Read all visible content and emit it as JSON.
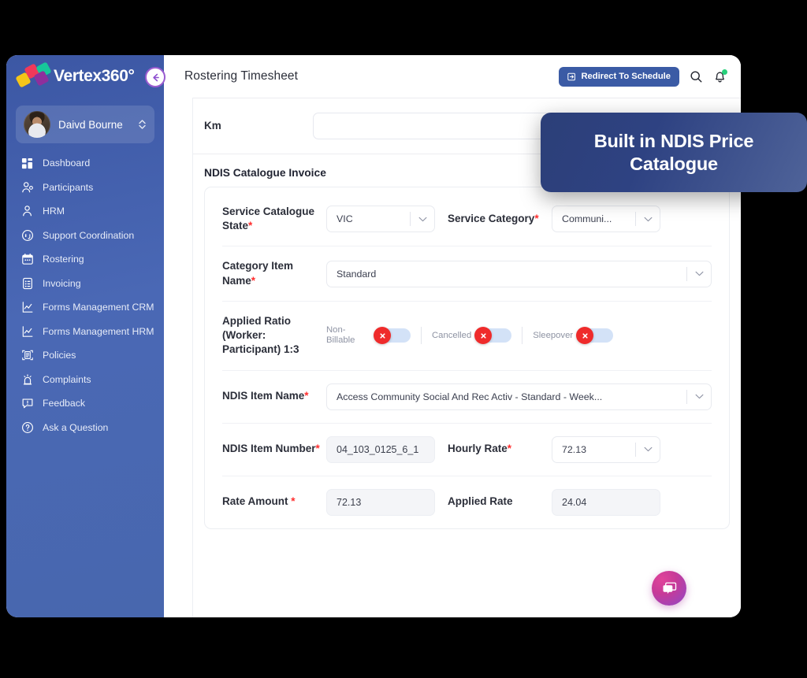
{
  "brand": {
    "name": "Vertex360°",
    "logo_icon": "vertex-diamond-logo"
  },
  "profile": {
    "name": "Daivd Bourne",
    "chevron_icon": "up-down-chevron-icon",
    "avatar_icon": "user-avatar"
  },
  "sidebar": {
    "items": [
      {
        "label": "Dashboard",
        "icon": "dashboard-grid-icon"
      },
      {
        "label": "Participants",
        "icon": "participants-people-icon"
      },
      {
        "label": "HRM",
        "icon": "hrm-person-icon"
      },
      {
        "label": "Support Coordination",
        "icon": "headset-support-icon"
      },
      {
        "label": "Rostering",
        "icon": "calendar-icon"
      },
      {
        "label": "Invoicing",
        "icon": "invoice-document-icon"
      },
      {
        "label": "Forms Management CRM",
        "icon": "chart-line-icon"
      },
      {
        "label": "Forms Management HRM",
        "icon": "chart-line-icon"
      },
      {
        "label": "Policies",
        "icon": "policies-frame-icon"
      },
      {
        "label": "Complaints",
        "icon": "complaints-siren-icon"
      },
      {
        "label": "Feedback",
        "icon": "feedback-comment-icon"
      },
      {
        "label": "Ask a Question",
        "icon": "question-circle-icon"
      }
    ]
  },
  "topbar": {
    "back_icon": "back-arrow-icon",
    "title": "Rostering Timesheet",
    "redirect_label": "Redirect To Schedule",
    "redirect_icon": "redirect-export-icon",
    "search_icon": "search-icon",
    "bell_icon": "notification-bell-icon",
    "bell_badge": true
  },
  "callout": {
    "text": "Built in NDIS Price Catalogue",
    "color": "#2e4282"
  },
  "form": {
    "km": {
      "label": "Km",
      "value": "",
      "placeholder": ""
    },
    "section_title": "NDIS Catalogue Invoice",
    "service_catalogue_state": {
      "label": "Service Catalogue State",
      "required": true,
      "value": "VIC"
    },
    "service_category": {
      "label": "Service Category",
      "required": true,
      "value": "Communi..."
    },
    "category_item_name": {
      "label": "Category Item Name",
      "required": true,
      "value": "Standard"
    },
    "applied_ratio": {
      "label": "Applied Ratio (Worker: Participant) 1:3"
    },
    "toggles": [
      {
        "label": "Non-Billable",
        "state": "off",
        "icon": "toggle-off-cross-icon"
      },
      {
        "label": "Cancelled",
        "state": "off",
        "icon": "toggle-off-cross-icon"
      },
      {
        "label": "Sleepover",
        "state": "off",
        "icon": "toggle-off-cross-icon"
      }
    ],
    "ndis_item_name": {
      "label": "NDIS Item Name",
      "required": true,
      "value": "Access Community Social And Rec Activ - Standard - Week..."
    },
    "ndis_item_number": {
      "label": "NDIS Item Number",
      "required": true,
      "value": "04_103_0125_6_1"
    },
    "hourly_rate": {
      "label": "Hourly Rate",
      "required": true,
      "value": "72.13"
    },
    "rate_amount": {
      "label": "Rate Amount ",
      "required": true,
      "value": "72.13"
    },
    "applied_rate": {
      "label": "Applied Rate",
      "required": false,
      "value": "24.04"
    }
  },
  "chat": {
    "icon": "chat-bubble-icon"
  }
}
